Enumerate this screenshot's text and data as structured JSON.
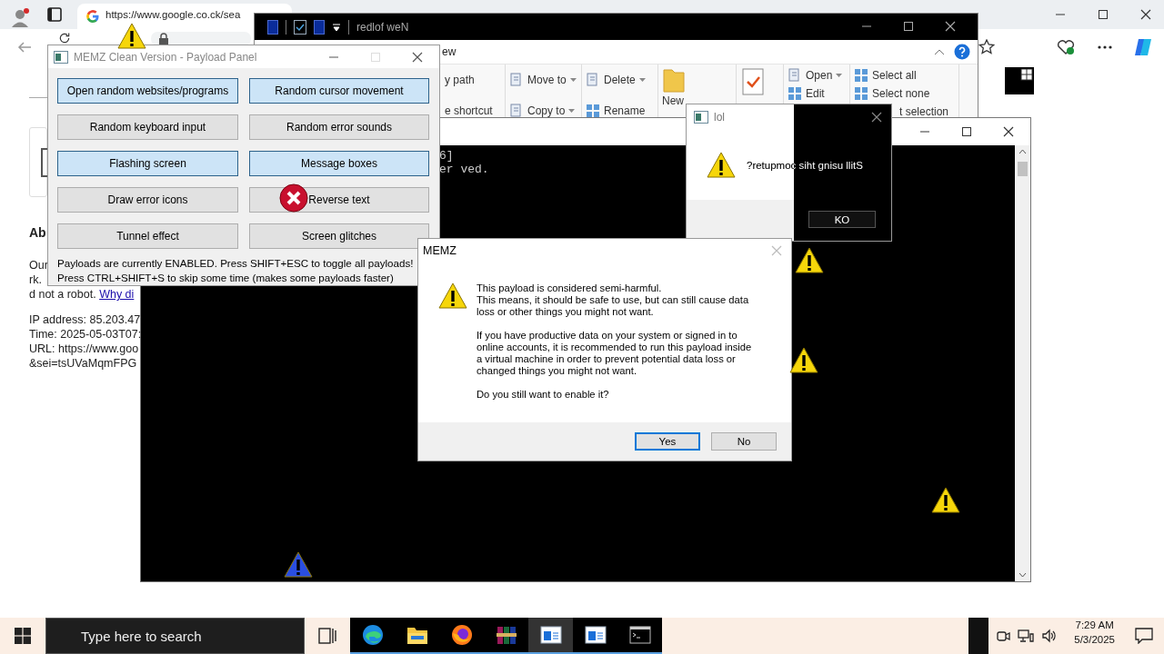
{
  "browser": {
    "tab_title": "https://www.google.co.ck/sea",
    "page": {
      "heading": "Ab",
      "lines": [
        "Our",
        "rk."
      ],
      "robot_text": "d not a robot. ",
      "robot_link": "Why di",
      "details": [
        "IP address: 85.203.47",
        "Time: 2025-05-03T07:",
        "URL: https://www.goo",
        "&sei=tsUVaMqmFPG"
      ]
    }
  },
  "explorer": {
    "title": "redlof weN",
    "tab": "ew",
    "ribbon": [
      {
        "items": [
          {
            "label": "y path",
            "kind": "plain"
          },
          {
            "label": "e shortcut",
            "kind": "plain"
          }
        ]
      },
      {
        "items": [
          {
            "label": "Move to",
            "kind": "menu"
          },
          {
            "label": "Copy to",
            "kind": "menu"
          }
        ]
      },
      {
        "items": [
          {
            "label": "Delete",
            "kind": "menu"
          },
          {
            "label": "Rename",
            "kind": "action"
          }
        ]
      },
      {
        "items": [
          {
            "label": "New",
            "kind": "large"
          }
        ]
      },
      {
        "items": [
          {
            "label": "Open",
            "kind": "menu"
          },
          {
            "label": "Edit",
            "kind": "action"
          }
        ]
      },
      {
        "items": [
          {
            "label": "Select all",
            "kind": "action"
          },
          {
            "label": "Select none",
            "kind": "action"
          },
          {
            "label": "t selection",
            "kind": "plain"
          }
        ]
      }
    ]
  },
  "console": {
    "lines": [
      "6]",
      "er ved."
    ]
  },
  "payload_panel": {
    "title": "MEMZ Clean Version - Payload Panel",
    "payloads": [
      {
        "label": "Open random websites/programs",
        "enabled": true
      },
      {
        "label": "Random cursor movement",
        "enabled": true
      },
      {
        "label": "Random keyboard input",
        "enabled": false
      },
      {
        "label": "Random error sounds",
        "enabled": false
      },
      {
        "label": "Flashing screen",
        "enabled": true
      },
      {
        "label": "Message boxes",
        "enabled": true
      },
      {
        "label": "Draw error icons",
        "enabled": false
      },
      {
        "label": "Reverse text",
        "enabled": false
      },
      {
        "label": "Tunnel effect",
        "enabled": false
      },
      {
        "label": "Screen glitches",
        "enabled": false
      }
    ],
    "notes": [
      "Payloads are currently ENABLED. Press SHIFT+ESC to toggle all payloads!",
      "Press CTRL+SHIFT+S to skip some time (makes some payloads faster)"
    ]
  },
  "lol_dialog": {
    "title": "lol",
    "message": "?retupmoc siht gnisu llitS",
    "button": "KO"
  },
  "memz_dialog": {
    "title": "MEMZ",
    "paragraphs": [
      "This payload is considered semi-harmful.\nThis means, it should be safe to use, but can still cause data\nloss or other things you might not want.",
      "If you have productive data on your system or signed in to\nonline accounts, it is recommended to run this payload inside\na virtual machine in order to prevent potential data loss or\nchanged things you might not want.",
      "Do you still want to enable it?"
    ],
    "buttons": [
      {
        "label": "Yes",
        "selected": true
      },
      {
        "label": "No",
        "selected": false
      }
    ]
  },
  "taskbar": {
    "search": {
      "placeholder": "Type here to search"
    },
    "apps": [
      {
        "kind": "edge",
        "selected": false
      },
      {
        "kind": "folder",
        "selected": false
      },
      {
        "kind": "fox",
        "selected": false
      },
      {
        "kind": "archive",
        "selected": false
      },
      {
        "kind": "window",
        "selected": true
      },
      {
        "kind": "window",
        "selected": false
      },
      {
        "kind": "terminal",
        "selected": false
      }
    ],
    "time": "7:29 AM",
    "date": "5/3/2025"
  }
}
